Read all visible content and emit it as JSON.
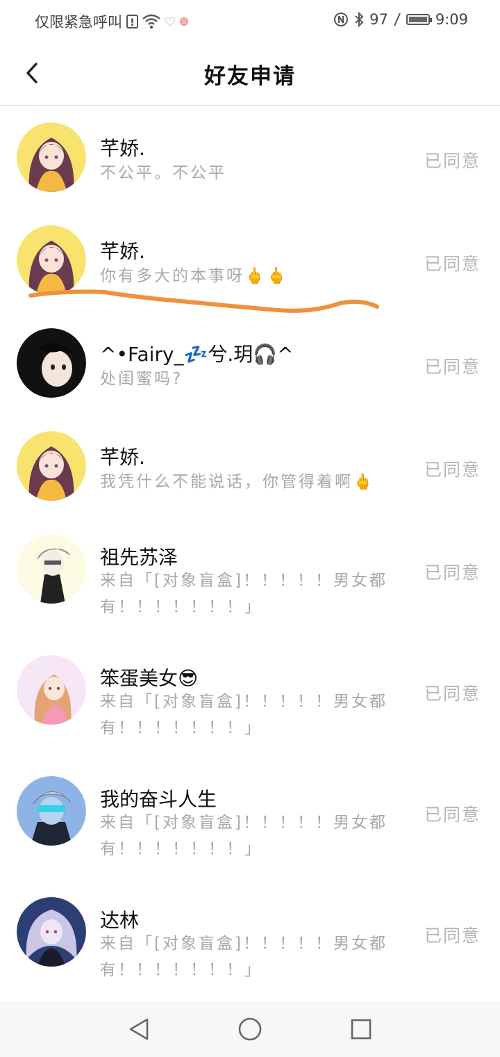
{
  "status_bar": {
    "carrier": "仅限紧急呼叫",
    "battery": "97",
    "time": "9:09"
  },
  "header": {
    "title": "好友申请",
    "back_icon": "chevron-left-icon"
  },
  "requests": [
    {
      "name": "芊娇.",
      "message": "不公平。不公平",
      "status": "已同意",
      "avatar": "anime-girl-avatar"
    },
    {
      "name": "芊娇.",
      "message": "你有多大的本事呀🖕🖕",
      "status": "已同意",
      "avatar": "anime-girl-avatar"
    },
    {
      "name": "^•Fairy_💤兮.玥🎧^",
      "message": "处闺蜜吗?",
      "status": "已同意",
      "avatar": "dark-hair-avatar"
    },
    {
      "name": "芊娇.",
      "message": "我凭什么不能说话，你管得着啊🖕",
      "status": "已同意",
      "avatar": "anime-girl-avatar"
    },
    {
      "name": "祖先苏泽",
      "message": "来自「[对象盲盒]！！！！！男女都有！！！！！！！」",
      "status": "已同意",
      "avatar": "white-hair-avatar"
    },
    {
      "name": "笨蛋美女😎",
      "message": "来自「[对象盲盒]！！！！！男女都有！！！！！！！」",
      "status": "已同意",
      "avatar": "pink-girl-avatar"
    },
    {
      "name": "我的奋斗人生",
      "message": "来自「[对象盲盒]！！！！！男女都有！！！！！！！」",
      "status": "已同意",
      "avatar": "blue-visor-avatar"
    },
    {
      "name": "达林",
      "message": "来自「[对象盲盒]！！！！！男女都有！！！！！！！」",
      "status": "已同意",
      "avatar": "silver-hair-avatar"
    }
  ],
  "nav_bar": {
    "back": "triangle-back-icon",
    "home": "circle-home-icon",
    "recents": "square-recents-icon"
  },
  "colors": {
    "annotation_stroke": "#f0903c",
    "status_text": "#b5b5b5",
    "message_text": "#a8a8a8"
  }
}
